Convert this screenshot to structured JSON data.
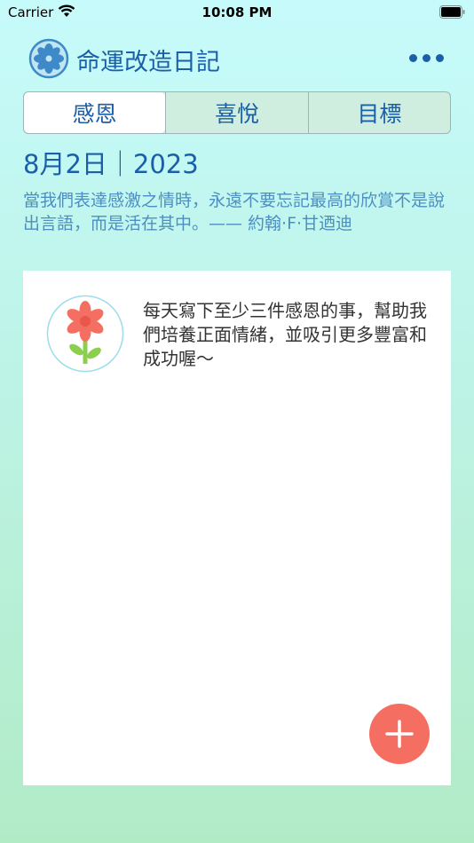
{
  "status": {
    "carrier": "Carrier",
    "time": "10:08 PM"
  },
  "header": {
    "title": "命運改造日記",
    "more_icon": "ellipsis-icon",
    "logo_icon": "flower-logo-icon"
  },
  "tabs": [
    {
      "label": "感恩",
      "selected": true
    },
    {
      "label": "喜悅",
      "selected": false
    },
    {
      "label": "目標",
      "selected": false
    }
  ],
  "date": {
    "text": "8月2日｜2023"
  },
  "quote": "當我們表達感激之情時，永遠不要忘記最高的欣賞不是說出言語，而是活在其中。—— 約翰·F·甘迺迪",
  "card": {
    "prompt": "每天寫下至少三件感恩的事，幫助我們培養正面情緒，並吸引更多豐富和成功喔～",
    "avatar_icon": "flower-icon"
  },
  "fab": {
    "icon": "plus-icon"
  },
  "colors": {
    "accent": "#1a5fa8",
    "fab": "#f56e62",
    "quote": "#4e8fbf"
  }
}
